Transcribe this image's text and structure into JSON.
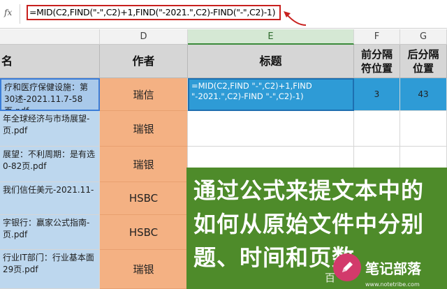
{
  "formula_bar": {
    "fx_label": "fx",
    "formula": "=MID(C2,FIND(\"-\",C2)+1,FIND(\"-2021.\",C2)-FIND(\"-\",C2)-1)"
  },
  "columns": [
    "D",
    "E",
    "F",
    "G"
  ],
  "headers": {
    "c": "名",
    "d": "作者",
    "e": "标题",
    "f": "前分隔符位置",
    "g": "后分隔位置"
  },
  "rows": [
    {
      "c": "疗和医疗保健设施：第30述-2021.11.7-58页.pdf",
      "d": "瑞信",
      "e": "=MID(C2,FIND \"-\",C2)+1,FIND \"-2021.\",C2)-FIND \"-\",C2)-1)",
      "f": "3",
      "g": "43"
    },
    {
      "c": "年全球经济与市场展望-页.pdf",
      "d": "瑞银",
      "e": "",
      "f": "",
      "g": ""
    },
    {
      "c": "展望：不利周期：是有选0-82页.pdf",
      "d": "瑞银",
      "e": "",
      "f": "",
      "g": ""
    },
    {
      "c": "我们信任美元-2021.11-",
      "d": "HSBC",
      "e": "",
      "f": "",
      "g": ""
    },
    {
      "c": "字银行：赢家公式指南-页.pdf",
      "d": "HSBC",
      "e": "",
      "f": "",
      "g": ""
    },
    {
      "c": "行业IT部门：行业基本面29页.pdf",
      "d": "瑞银",
      "e": "",
      "f": "",
      "g": ""
    }
  ],
  "overlay": {
    "line1": "通过公式来提文本中的",
    "line2": "如何从原始文件中分别",
    "line3": "题、时间和页数",
    "small": "百",
    "logo_text": "笔记部落",
    "logo_url": "www.notetribe.com"
  },
  "colors": {
    "formula_border": "#c8201e",
    "selected_cell": "#2e9bd6",
    "column_c_fill": "#bdd7ee",
    "column_d_fill": "#f4b183",
    "header_fill": "#d6d6d6",
    "overlay_fill": "#4e8b2a",
    "logo_fill": "#d23a6b"
  }
}
